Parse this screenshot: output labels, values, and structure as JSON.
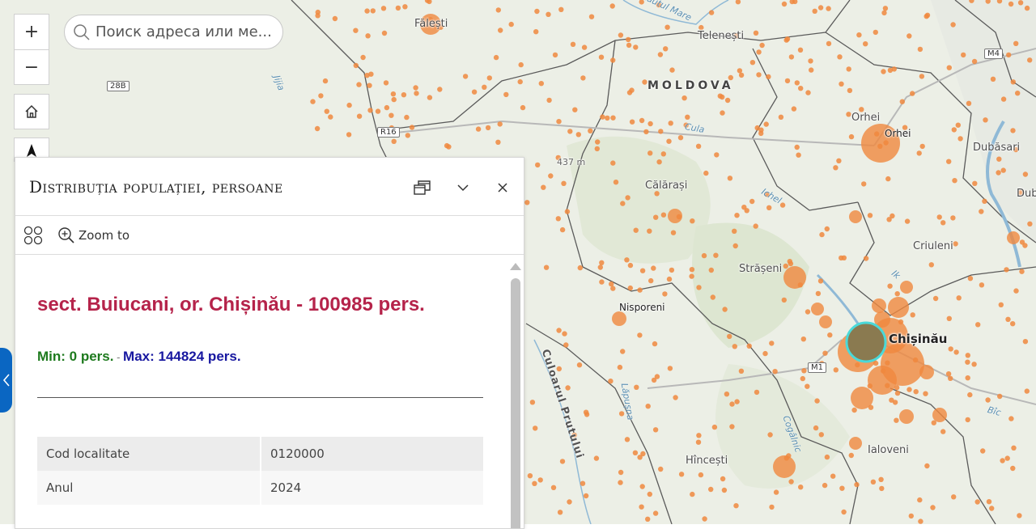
{
  "map": {
    "labels": {
      "moldova": "MOLDOVA",
      "falesti": "Fălești",
      "telenesti": "Telenești",
      "orhei": "Orhei",
      "orhei_city": "Orhei",
      "dubasari": "Dubăsari",
      "calarasi": "Călărași",
      "criuleni": "Criuleni",
      "straseni": "Strășeni",
      "nisporeni": "Nisporeni",
      "chisinau": "Chișinău",
      "ialoveni": "Ialoveni",
      "hincesti": "Hîncești",
      "corridor": "Culoarul Prutului",
      "elevation": "437 m",
      "dub": "Dub"
    },
    "rivers": {
      "raut": "Răutul Mare",
      "cula": "Cula",
      "ichel": "Ichel",
      "bac": "Bîc",
      "cogalnic": "Cogâlnic",
      "jijia": "Jijia",
      "lapusna": "Lăpușna",
      "ikel": "Ik"
    },
    "roads": {
      "r16": "R16",
      "r28b": "28B",
      "m4": "M4",
      "m1": "M1"
    }
  },
  "controls": {
    "zoom_in": "+",
    "zoom_out": "−",
    "search_placeholder": "Поиск адреса или ме..."
  },
  "popup": {
    "title": "Distribuția populației, persoane",
    "zoom_to": "Zoom to",
    "feature_title": "sect. Buiucani, or. Chișinău - 100985 pers.",
    "min_text": "Min: 0 pers.",
    "separator": " - ",
    "max_text": "Max: 144824 pers.",
    "attributes": [
      {
        "key": "Cod localitate",
        "value": "0120000"
      },
      {
        "key": "Anul",
        "value": "2024"
      }
    ]
  },
  "colors": {
    "point": "#f0883e",
    "selected": "#4ad9d9",
    "title": "#b5234a",
    "min": "#1e7a1e",
    "max": "#1818a0"
  }
}
